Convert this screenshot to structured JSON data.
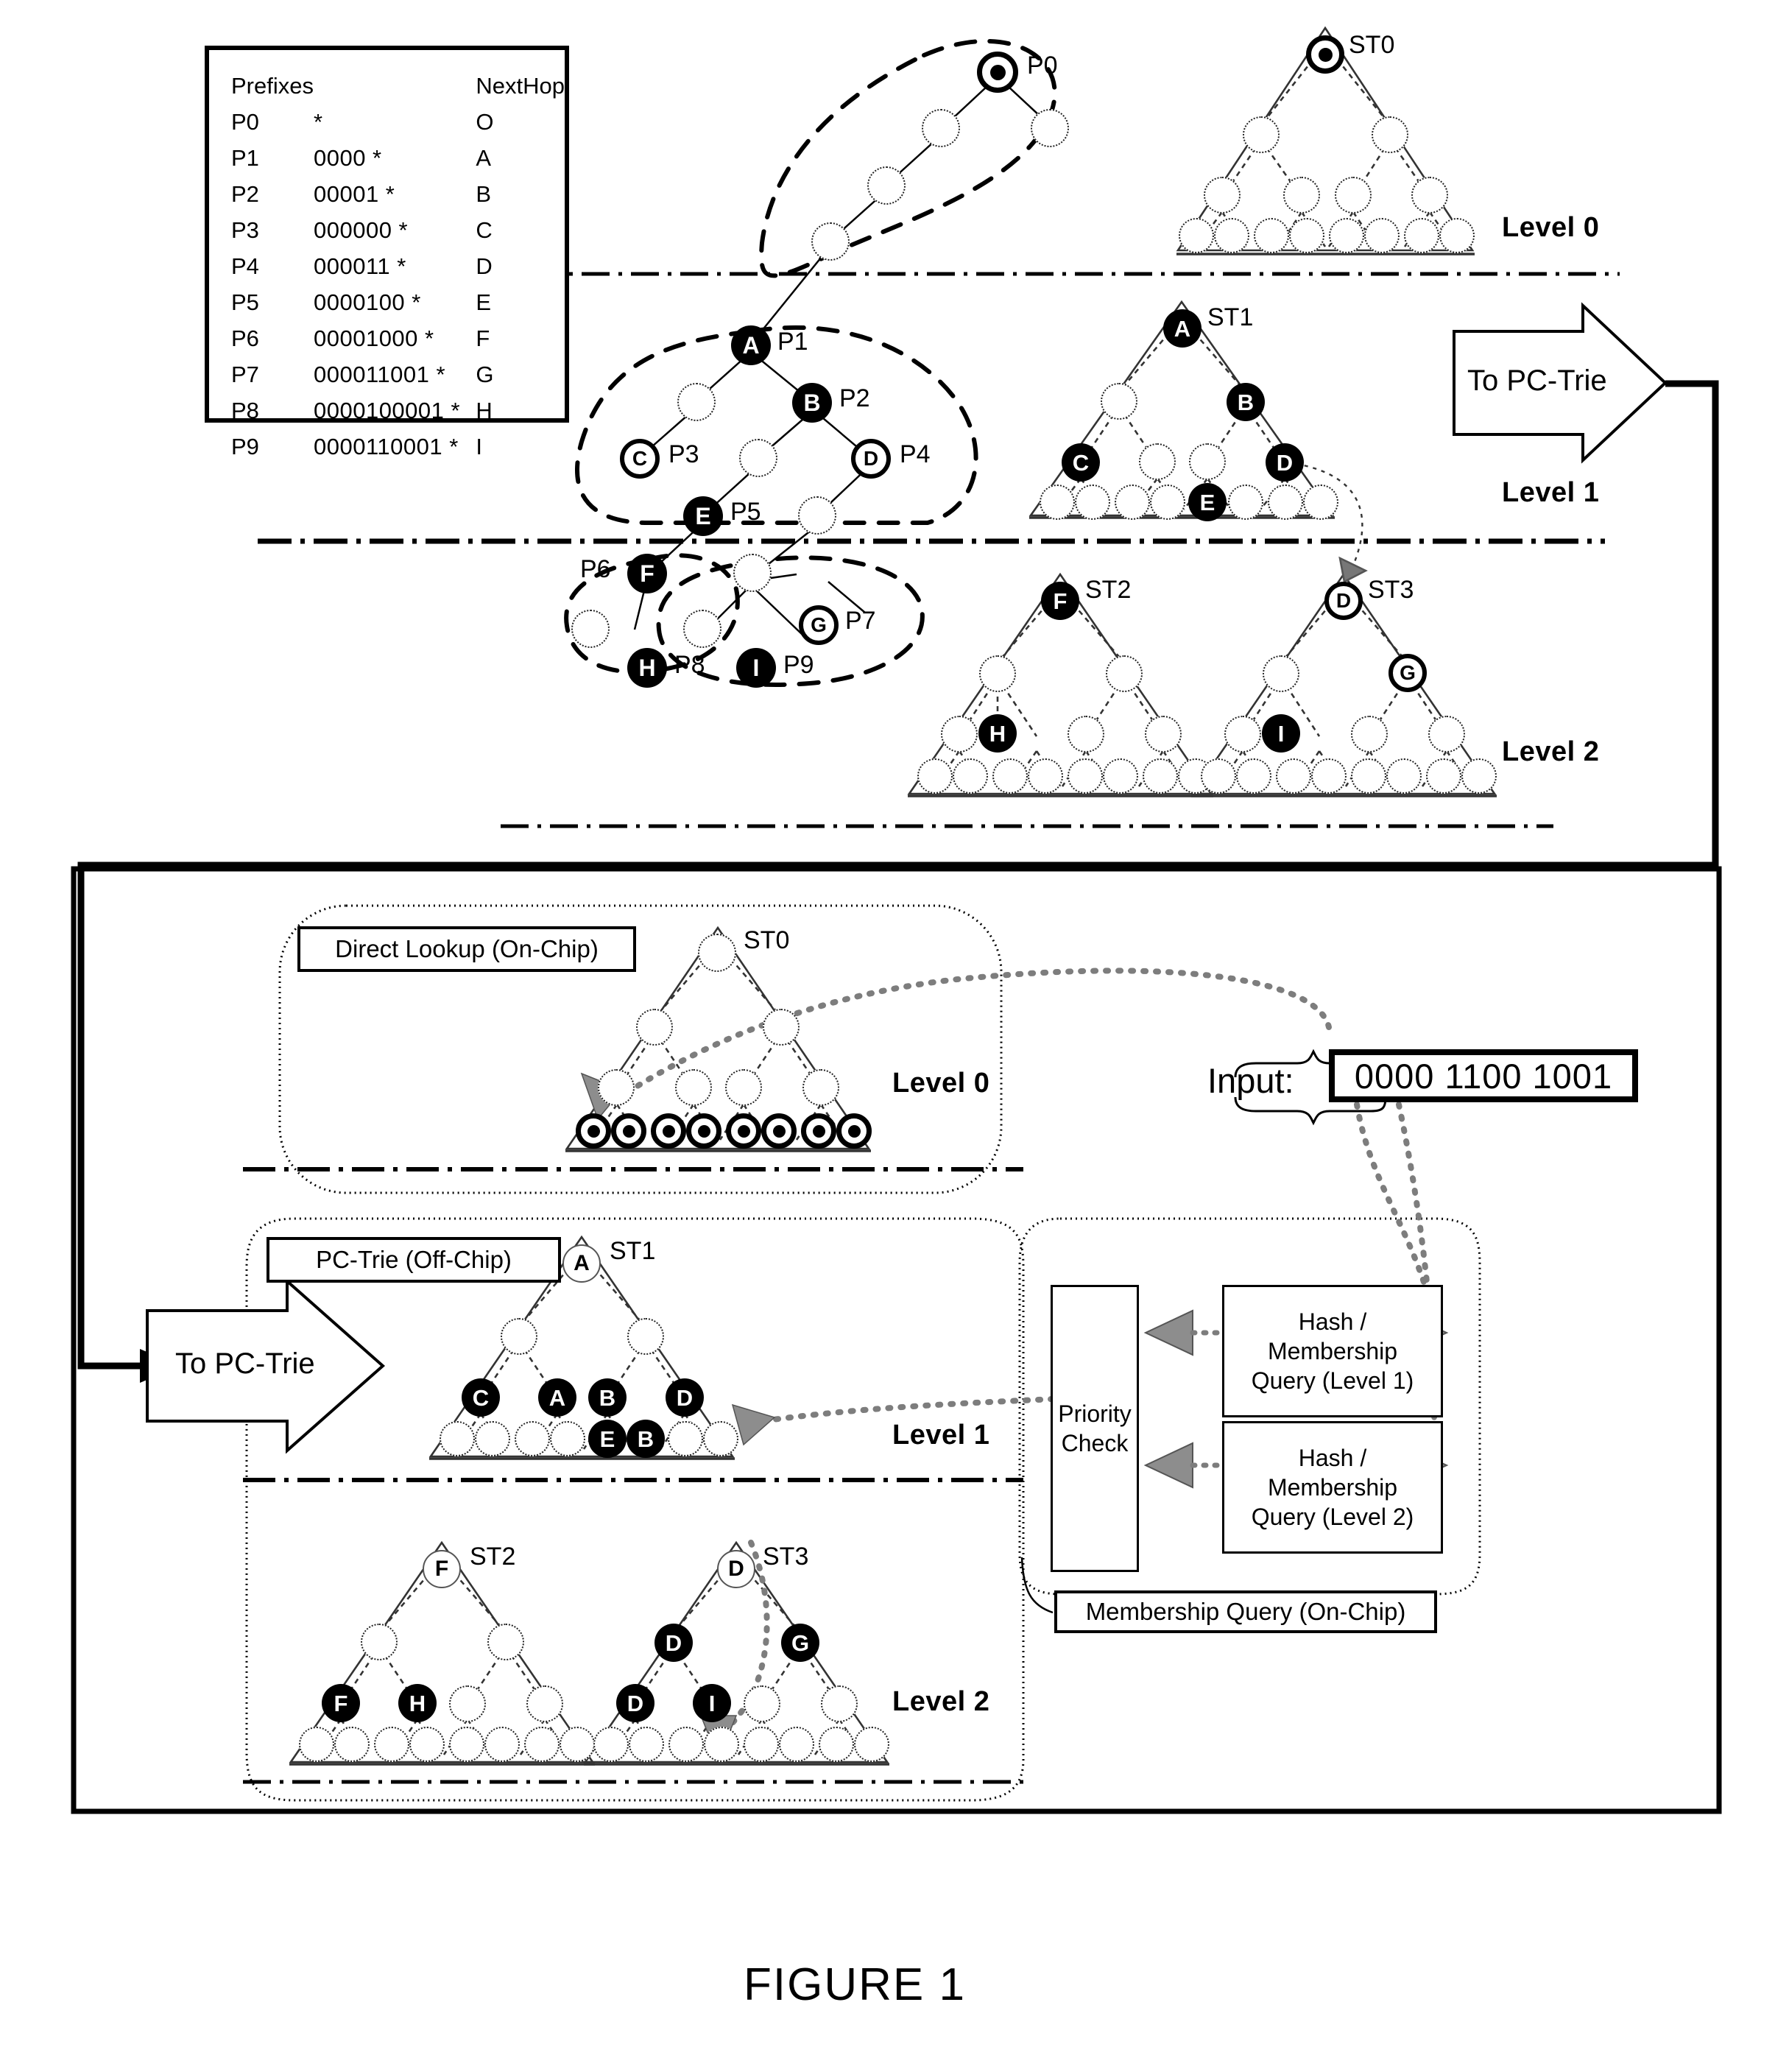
{
  "figure": {
    "caption": "FIGURE 1"
  },
  "prefix_table": {
    "headers": [
      "Prefixes",
      "",
      "NextHop"
    ],
    "rows": [
      {
        "id": "P0",
        "bits": "*",
        "hop": "O"
      },
      {
        "id": "P1",
        "bits": "0000 *",
        "hop": "A"
      },
      {
        "id": "P2",
        "bits": "00001 *",
        "hop": "B"
      },
      {
        "id": "P3",
        "bits": "000000 *",
        "hop": "C"
      },
      {
        "id": "P4",
        "bits": "000011 *",
        "hop": "D"
      },
      {
        "id": "P5",
        "bits": "0000100 *",
        "hop": "E"
      },
      {
        "id": "P6",
        "bits": "00001000 *",
        "hop": "F"
      },
      {
        "id": "P7",
        "bits": "000011001 *",
        "hop": "G"
      },
      {
        "id": "P8",
        "bits": "0000100001 *",
        "hop": "H"
      },
      {
        "id": "P9",
        "bits": "0000110001 *",
        "hop": "I"
      }
    ]
  },
  "levels": {
    "l0": "Level 0",
    "l1": "Level 1",
    "l2": "Level 2"
  },
  "subtries": {
    "st0": "ST0",
    "st1": "ST1",
    "st2": "ST2",
    "st3": "ST3"
  },
  "prefix_marks": {
    "p0": "P0",
    "p1": "P1",
    "p2": "P2",
    "p3": "P3",
    "p4": "P4",
    "p5": "P5",
    "p6": "P6",
    "p7": "P7",
    "p8": "P8",
    "p9": "P9"
  },
  "node_letters": {
    "o": "O",
    "a": "A",
    "b": "B",
    "c": "C",
    "d": "D",
    "e": "E",
    "f": "F",
    "g": "G",
    "h": "H",
    "i": "I"
  },
  "arrows": {
    "to_pc_trie_top": "To PC-Trie",
    "to_pc_trie_bottom": "To PC-Trie"
  },
  "bottom_panel": {
    "direct_lookup": "Direct Lookup  (On-Chip)",
    "pc_trie": "PC-Trie (Off-Chip)",
    "membership_query": "Membership Query  (On-Chip)",
    "priority_check": "Priority\nCheck",
    "priority_check_line1": "Priority",
    "priority_check_line2": "Check",
    "hash_l1_line1": "Hash /",
    "hash_l1_line2": "Membership",
    "hash_l1_line3": "Query (Level 1)",
    "hash_l2_line1": "Hash /",
    "hash_l2_line2": "Membership",
    "hash_l2_line3": "Query (Level 2)"
  },
  "input": {
    "label": "Input:",
    "value": "0000 1100 1001",
    "chunks": [
      "0000",
      "1100",
      "1001"
    ]
  },
  "colors": {
    "ink": "#000000",
    "paper": "#ffffff",
    "arrow_gray": "#888888"
  }
}
